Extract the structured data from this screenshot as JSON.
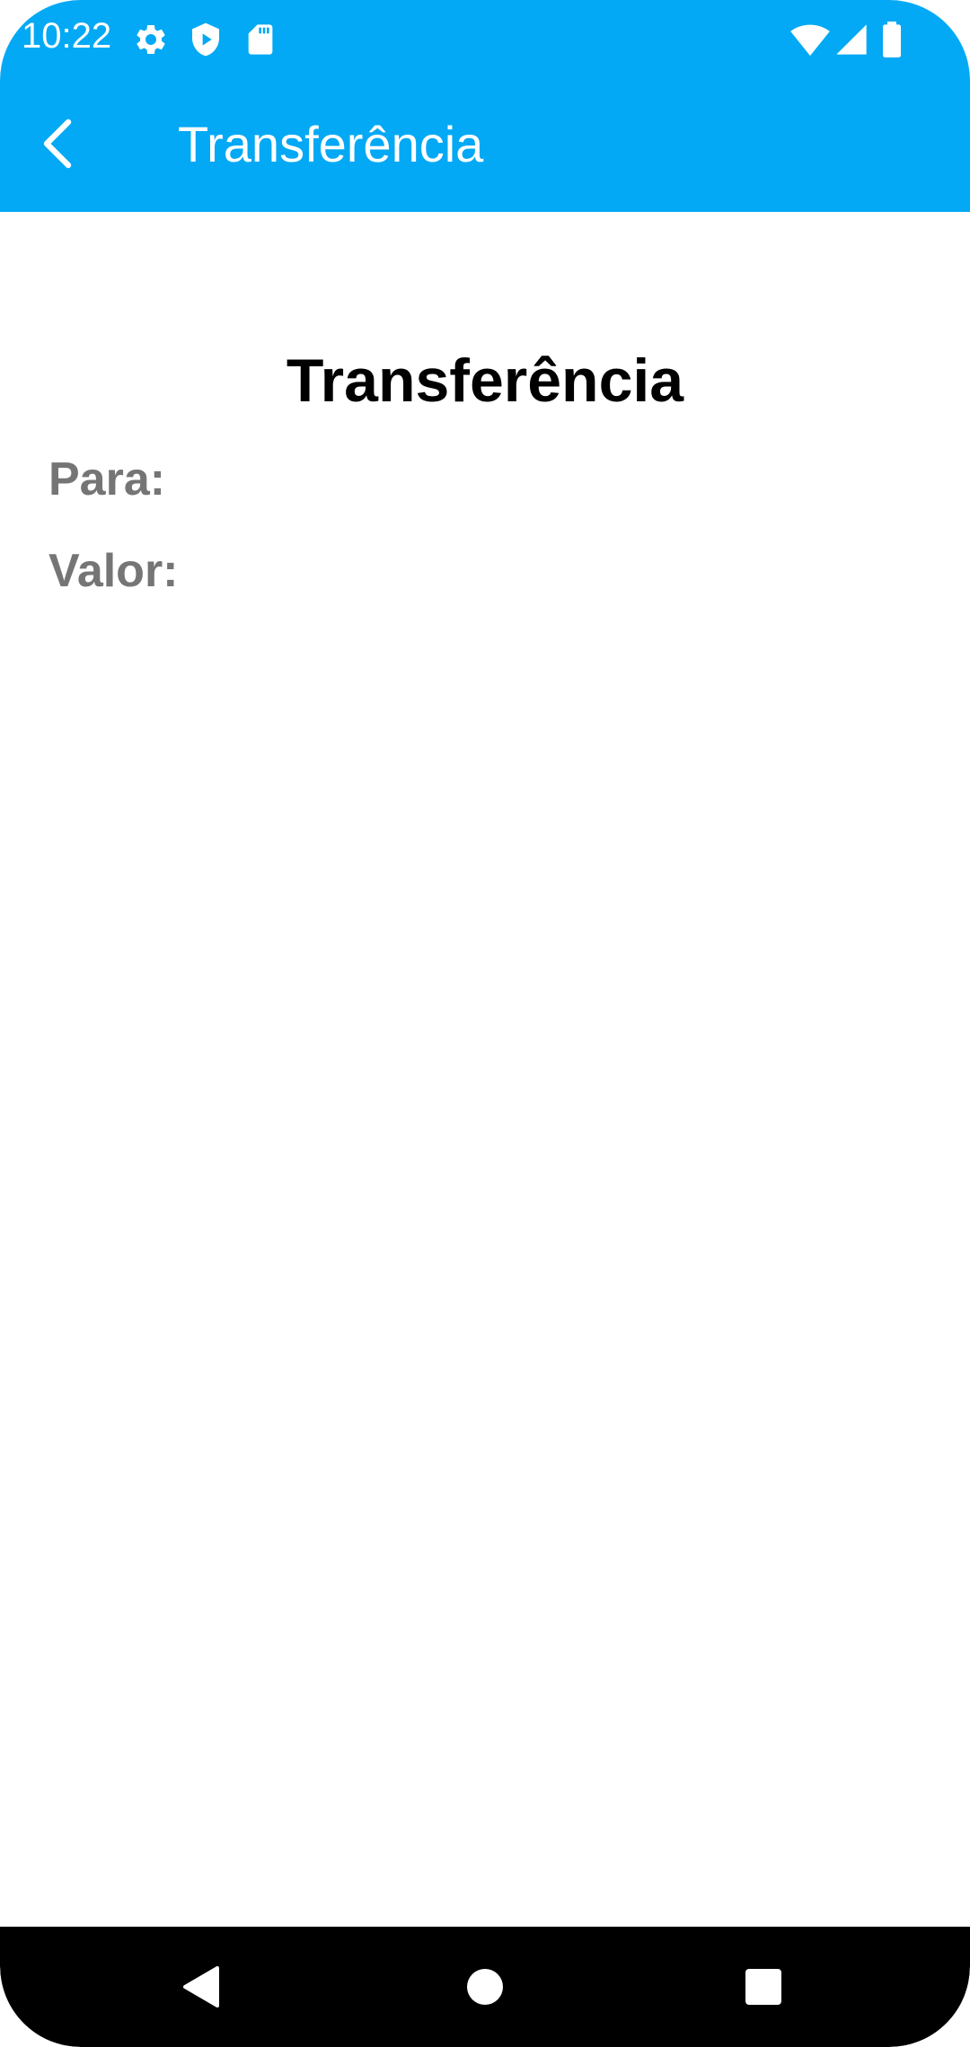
{
  "status_bar": {
    "time": "10:22",
    "icons_left": [
      "gear-icon",
      "shield-play-icon",
      "sd-card-icon"
    ],
    "icons_right": [
      "wifi-icon",
      "cell-signal-icon",
      "battery-icon"
    ]
  },
  "app_bar": {
    "back_icon": "arrow-back-icon",
    "title": "Transferência"
  },
  "main": {
    "title": "Transferência",
    "fields": [
      {
        "label": "Para:"
      },
      {
        "label": "Valor:"
      }
    ]
  },
  "nav_bar": {
    "buttons": [
      "back-triangle-icon",
      "home-circle-icon",
      "recents-square-icon"
    ]
  },
  "colors": {
    "primary": "#03A9F4",
    "label_gray": "#757575",
    "nav_background": "#000000"
  }
}
